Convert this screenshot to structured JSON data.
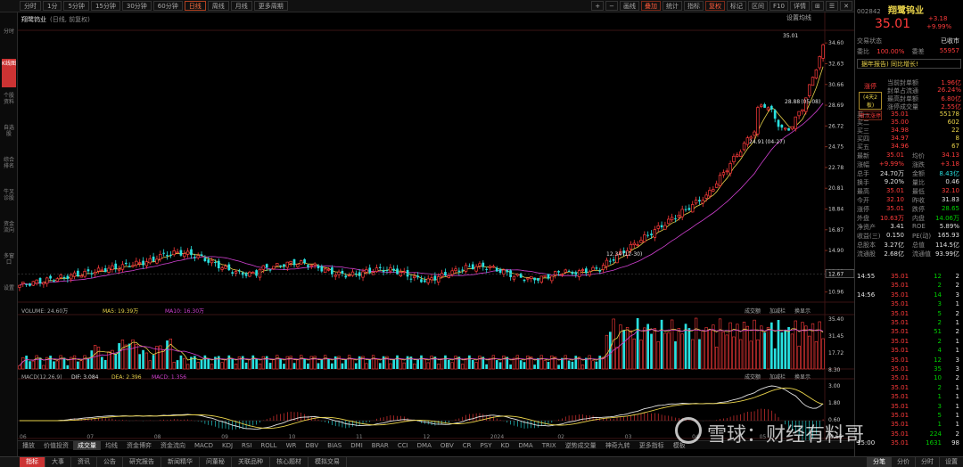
{
  "toolbar": {
    "periods": [
      "分时",
      "1分",
      "5分钟",
      "15分钟",
      "30分钟",
      "60分钟",
      "日线",
      "周线",
      "月线",
      "更多周期"
    ],
    "active_period": "日线",
    "right_buttons": [
      "画线",
      "叠加",
      "统计",
      "指标",
      "复权",
      "标记",
      "区间",
      "F10",
      "详情"
    ],
    "icon_buttons": [
      "+",
      "−",
      "⊞",
      "☰",
      "✕"
    ],
    "red_buttons": [
      "复权",
      "叠加"
    ]
  },
  "sidebar": {
    "items": [
      "分时",
      "K线图",
      "个股资料",
      "自选股",
      "综合排名",
      "牛叉诊股",
      "资金流向",
      "多窗口",
      "设置"
    ],
    "active": "K线图"
  },
  "chart": {
    "stock_label": "翔鹭钨业",
    "stock_label_suffix": "(日线, 前复权)",
    "settings_label": "设置均线",
    "price_axis": [
      "34.60",
      "32.63",
      "30.66",
      "28.69",
      "26.72",
      "24.75",
      "22.78",
      "20.81",
      "18.84",
      "16.87",
      "14.90",
      "12.93",
      "10.96"
    ],
    "annotation_high": "35.01",
    "annotation_mid": "28.88",
    "annotation_mid_date": "(05-08)",
    "annotation_low1": "24.91",
    "annotation_low1_date": "(04-27)",
    "annotation_low2": "12.34",
    "annotation_low2_date": "(12-30)",
    "price_tag": "12.67",
    "date_left": "2023-05-19",
    "volume_info": "VOLUME: 24.60万",
    "vol_ma5": "MA5: 19.39万",
    "vol_ma10": "MA10: 16.30万",
    "vol_buttons": [
      "成交额",
      "加减栏",
      "换显示"
    ],
    "vol_axis": [
      "35.40",
      "31.45",
      "17.72",
      "8.30"
    ],
    "macd_info": "MACD(12,26,9)",
    "macd_dif": "DIF: 3.084",
    "macd_dea": "DEA: 2.396",
    "macd_val": "MACD: 1.356",
    "macd_buttons": [
      "成交额",
      "加减栏",
      "换显示"
    ],
    "macd_axis": [
      "3.00",
      "1.80",
      "0.60",
      "-0.65"
    ],
    "x_labels": [
      "06",
      "07",
      "08",
      "09",
      "10",
      "11",
      "12",
      "2024",
      "02",
      "03",
      "04",
      "05"
    ],
    "colors": {
      "up": "#ff3b3b",
      "down": "#28e0e0",
      "ma1": "#e8d24a",
      "ma2": "#d040d0"
    }
  },
  "indicators": {
    "tabs": [
      "播放",
      "价值投资",
      "成交量",
      "均线",
      "资金博弈",
      "资金流向",
      "MACD",
      "KDJ",
      "RSI",
      "ROLL",
      "WR",
      "DBV",
      "BIAS",
      "DMI",
      "BRAR",
      "CCI",
      "DMA",
      "OBV",
      "CR",
      "PSY",
      "KD",
      "DMA",
      "TRIX",
      "逆势成交量",
      "神奇九转",
      "更多指标",
      "模板"
    ],
    "active": "成交量"
  },
  "bottom": {
    "tabs": [
      "指标",
      "大事",
      "资讯",
      "公告",
      "研究报告",
      "新闻精华",
      "问董秘",
      "关联品种",
      "核心题材",
      "模拟交易"
    ],
    "active": "指标",
    "right_tabs": [
      "分笔",
      "分价",
      "分时",
      "设置"
    ],
    "right_active": "分笔"
  },
  "quote": {
    "code": "002842",
    "name": "翔鹭钨业",
    "price": "35.01",
    "change": "+3.18",
    "change_pct": "+9.99%",
    "status_label": "交易状态",
    "status_value": "已收市",
    "ratio_label": "委比",
    "ratio_value": "100.00%",
    "diff_label": "委差",
    "diff_value": "55957",
    "news_headline": "据年报告) 同比增长!",
    "tag1": "涨停",
    "tag2": "(4天2板)",
    "tag3": "首次涨停",
    "seal_rows": [
      {
        "label": "当前封单额",
        "value": "1.96亿"
      },
      {
        "label": "封单占流通",
        "value": "26.24%"
      },
      {
        "label": "最高封单额",
        "value": "6.80亿"
      },
      {
        "label": "涨停成交量",
        "value": "2.55亿"
      }
    ],
    "sell_rows": [
      {
        "label": "卖五",
        "price": "",
        "vol": ""
      },
      {
        "label": "卖四",
        "price": "",
        "vol": ""
      },
      {
        "label": "卖三",
        "price": "",
        "vol": ""
      },
      {
        "label": "卖二",
        "price": "",
        "vol": ""
      },
      {
        "label": "卖一",
        "price": "",
        "vol": ""
      }
    ],
    "buy_rows": [
      {
        "label": "买一",
        "price": "35.01",
        "vol": "55178"
      },
      {
        "label": "买二",
        "price": "35.00",
        "vol": "602"
      },
      {
        "label": "买三",
        "price": "34.98",
        "vol": "22"
      },
      {
        "label": "买四",
        "price": "34.97",
        "vol": "8"
      },
      {
        "label": "买五",
        "price": "34.96",
        "vol": "67"
      }
    ],
    "stats": [
      {
        "l1": "最新",
        "v1": "35.01",
        "c1": "red",
        "l2": "均价",
        "v2": "34.13",
        "c2": "red"
      },
      {
        "l1": "涨幅",
        "v1": "+9.99%",
        "c1": "red",
        "l2": "涨跌",
        "v2": "+3.18",
        "c2": "red"
      },
      {
        "l1": "总手",
        "v1": "24.70万",
        "c1": "white",
        "l2": "金额",
        "v2": "8.43亿",
        "c2": "cyan"
      },
      {
        "l1": "换手",
        "v1": "9.20%",
        "c1": "white",
        "l2": "量比",
        "v2": "0.46",
        "c2": "white"
      },
      {
        "l1": "最高",
        "v1": "35.01",
        "c1": "red",
        "l2": "最低",
        "v2": "32.10",
        "c2": "red"
      },
      {
        "l1": "今开",
        "v1": "32.10",
        "c1": "red",
        "l2": "昨收",
        "v2": "31.83",
        "c2": "white"
      },
      {
        "l1": "涨停",
        "v1": "35.01",
        "c1": "red",
        "l2": "跌停",
        "v2": "28.65",
        "c2": "green"
      },
      {
        "l1": "外盘",
        "v1": "10.63万",
        "c1": "red",
        "l2": "内盘",
        "v2": "14.06万",
        "c2": "green"
      },
      {
        "l1": "净资产",
        "v1": "3.41",
        "c1": "white",
        "l2": "ROE",
        "v2": "5.89%",
        "c2": "white"
      },
      {
        "l1": "收益(三)",
        "v1": "0.150",
        "c1": "white",
        "l2": "PE(动)",
        "v2": "165.93",
        "c2": "white"
      },
      {
        "l1": "总股本",
        "v1": "3.27亿",
        "c1": "white",
        "l2": "总值",
        "v2": "114.5亿",
        "c2": "white"
      },
      {
        "l1": "流通股",
        "v1": "2.68亿",
        "c1": "white",
        "l2": "流通值",
        "v2": "93.99亿",
        "c2": "white"
      }
    ],
    "ticks": [
      {
        "t": "14:55",
        "p": "35.01",
        "v": "12",
        "n": "2"
      },
      {
        "t": "",
        "p": "35.01",
        "v": "2",
        "n": "2"
      },
      {
        "t": "14:56",
        "p": "35.01",
        "v": "14",
        "n": "3"
      },
      {
        "t": "",
        "p": "35.01",
        "v": "3",
        "n": "1"
      },
      {
        "t": "",
        "p": "35.01",
        "v": "5",
        "n": "2"
      },
      {
        "t": "",
        "p": "35.01",
        "v": "2",
        "n": "1"
      },
      {
        "t": "",
        "p": "35.01",
        "v": "51",
        "n": "2"
      },
      {
        "t": "",
        "p": "35.01",
        "v": "2",
        "n": "1"
      },
      {
        "t": "",
        "p": "35.01",
        "v": "4",
        "n": "1"
      },
      {
        "t": "",
        "p": "35.01",
        "v": "12",
        "n": "3"
      },
      {
        "t": "",
        "p": "35.01",
        "v": "35",
        "n": "3"
      },
      {
        "t": "",
        "p": "35.01",
        "v": "10",
        "n": "2"
      },
      {
        "t": "",
        "p": "35.01",
        "v": "2",
        "n": "1"
      },
      {
        "t": "",
        "p": "35.01",
        "v": "1",
        "n": "1"
      },
      {
        "t": "",
        "p": "35.01",
        "v": "3",
        "n": "1"
      },
      {
        "t": "",
        "p": "35.01",
        "v": "5",
        "n": "1"
      },
      {
        "t": "",
        "p": "35.01",
        "v": "1",
        "n": "1"
      },
      {
        "t": "",
        "p": "35.01",
        "v": "224",
        "n": "2"
      },
      {
        "t": "15:00",
        "p": "35.01",
        "v": "1631",
        "n": "98"
      }
    ]
  },
  "watermark": "雪球：财经有料哥"
}
